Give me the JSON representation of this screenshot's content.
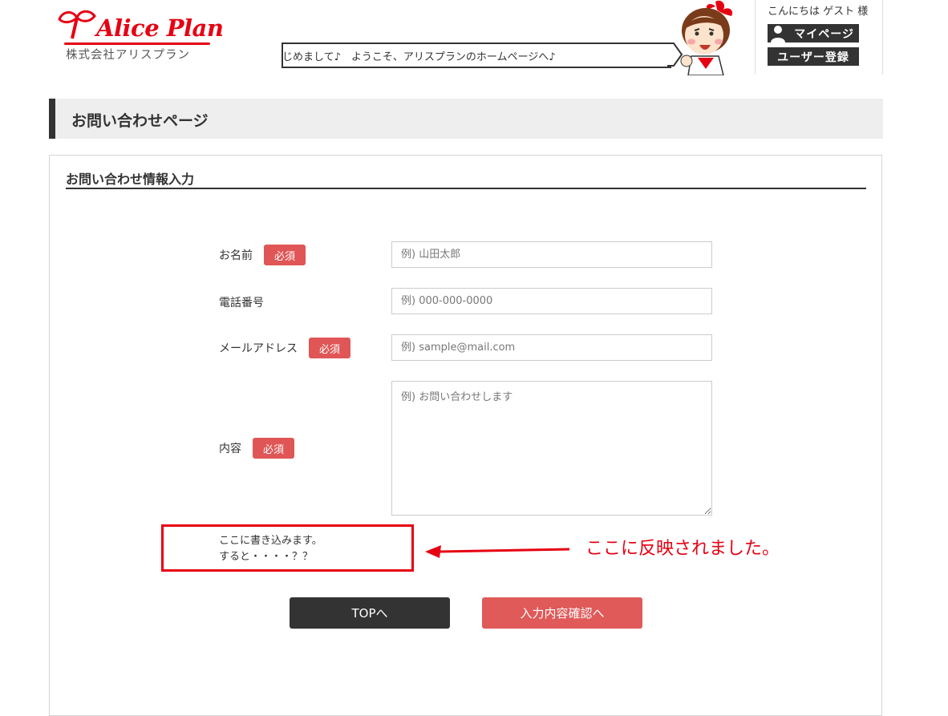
{
  "header": {
    "logo_title": "Alice Plan",
    "logo_subtitle": "株式会社アリスプラン",
    "speech_bubble": "はじめまして♪　ようこそ、アリスプランのホームページへ♪",
    "greeting": "こんにちは ゲスト 様",
    "mypage_label": "マイページ",
    "register_label": "ユーザー登録"
  },
  "page": {
    "title": "お問い合わせページ",
    "section_title": "お問い合わせ情報入力"
  },
  "form": {
    "required_badge": "必須",
    "name": {
      "label": "お名前",
      "placeholder": "例) 山田太郎",
      "value": ""
    },
    "phone": {
      "label": "電話番号",
      "placeholder": "例) 000-000-0000",
      "value": ""
    },
    "email": {
      "label": "メールアドレス",
      "placeholder": "例) sample@mail.com",
      "value": ""
    },
    "content": {
      "label": "内容",
      "placeholder": "例) お問い合わせします",
      "value": ""
    }
  },
  "preview": {
    "line1": "ここに書き込みます。",
    "line2": "すると・・・・？？"
  },
  "annotation": {
    "text": "ここに反映されました。",
    "color": "#e60012"
  },
  "buttons": {
    "top_label": "TOPへ",
    "confirm_label": "入力内容確認へ"
  },
  "colors": {
    "accent_red": "#e05656",
    "dark": "#333333",
    "brand_red": "#e60012"
  }
}
